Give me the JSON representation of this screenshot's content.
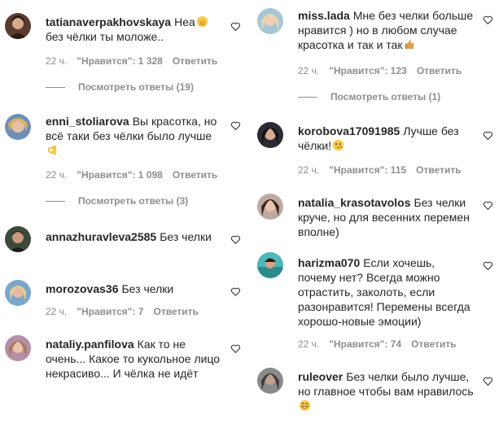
{
  "comments_left": [
    {
      "user": "tatianaverpakhovskaya",
      "text": "Неа",
      "emoji": "🙌",
      "text2": "без чёлки ты моложе..",
      "time": "22 ч.",
      "likes": "\"Нравится\": 1 328",
      "reply": "Ответить",
      "view_replies": "Посмотреть ответы (19)"
    },
    {
      "user": "enni_stoliarova",
      "text": "Вы красотка, но всё таки без чёлки было лучше",
      "emoji": "👌",
      "time": "22 ч.",
      "likes": "\"Нравится\": 1 098",
      "reply": "Ответить",
      "view_replies": "Посмотреть ответы (3)"
    },
    {
      "user": "annazhuravleva2585",
      "text": "Без челки"
    },
    {
      "user": "morozovas36",
      "text": "Без челки",
      "time": "22 ч.",
      "likes": "\"Нравится\": 7",
      "reply": "Ответить"
    },
    {
      "user": "nataliy.panfilova",
      "text": "Как то не очень... Какое то кукольное лицо некрасиво... И чёлка не идёт"
    }
  ],
  "comments_right": [
    {
      "user": "miss.lada",
      "text": "Мне без челки больше нравится ) но в любом случае красотка и так и так",
      "emoji": "👍",
      "time": "22 ч.",
      "likes": "\"Нравится\": 123",
      "reply": "Ответить",
      "view_replies": "Посмотреть ответы (1)"
    },
    {
      "user": "korobova17091985",
      "text": "Лучше без чёлки!",
      "emoji": "😘",
      "time": "22 ч.",
      "likes": "\"Нравится\": 115",
      "reply": "Ответить"
    },
    {
      "user": "natalia_krasotavolos",
      "text": "Без челки круче, но для весенних перемен вполне)"
    },
    {
      "user": "harizma070",
      "text": "Если хочешь, почему нет? Всегда можно отрастить, заколоть, если разонравится! Перемены всегда хорошо-новые эмоции)",
      "time": "22 ч.",
      "likes": "\"Нравится\": 74",
      "reply": "Ответить"
    },
    {
      "user": "ruleover",
      "text": "Без челки было лучше, но главное чтобы вам нравилось",
      "emoji": "😄"
    }
  ],
  "icons": {
    "like": "heart-outline-icon"
  },
  "colors": {
    "text": "#262626",
    "meta": "#8e8e8e"
  }
}
